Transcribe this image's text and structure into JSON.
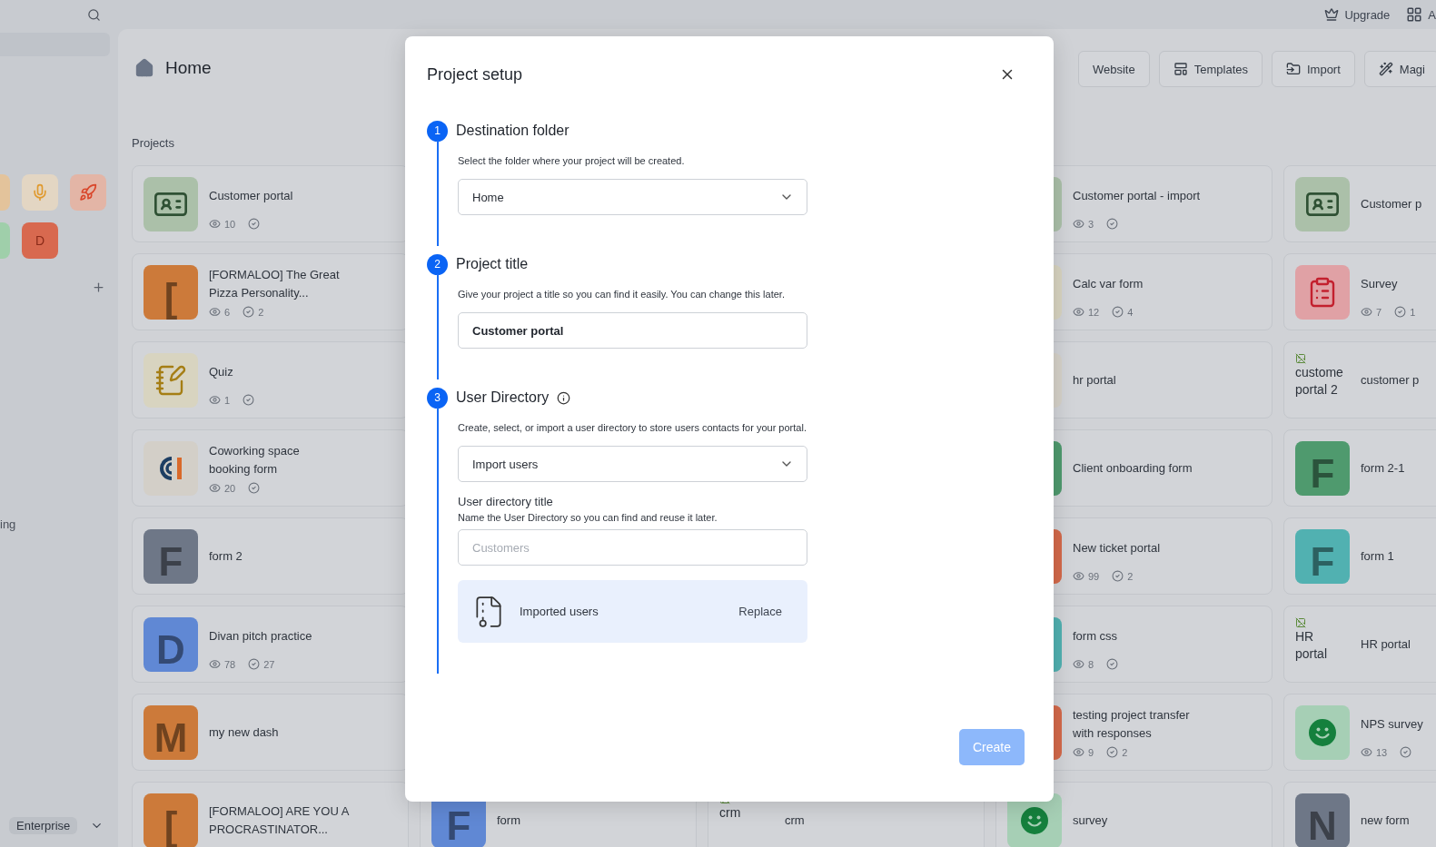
{
  "top_bar": {
    "actions": [
      {
        "label": "Upgrade"
      },
      {
        "label": "A"
      }
    ]
  },
  "sidebar": {
    "tiles": [
      {
        "kind": "blank",
        "color": "#e3c39b"
      },
      {
        "kind": "mic",
        "color": "#e3d6c3"
      },
      {
        "kind": "rocket",
        "color": "#e3b5a6"
      },
      {
        "kind": "blank",
        "color": "#9fcfaa"
      },
      {
        "kind": "letter",
        "label": "D",
        "color": "#d8694f"
      }
    ],
    "partial_label": "ing",
    "plan": "Enterprise"
  },
  "main": {
    "title": "Home",
    "section": "Projects",
    "toolbar": [
      {
        "label": "Website"
      },
      {
        "label": "Templates"
      },
      {
        "label": "Import"
      },
      {
        "label": "Magi"
      }
    ],
    "columns": [
      {
        "cards": [
          {
            "title": "Customer portal",
            "views": "10",
            "icon": {
              "kind": "id-card",
              "color": "#abc0a9"
            }
          },
          {
            "title": "[FORMALOO] The Great\nPizza Personality...",
            "views": "6",
            "checks": "2",
            "icon": {
              "kind": "letter",
              "label": "[",
              "color": "#cc7a3a"
            }
          },
          {
            "title": "Quiz",
            "views": "1",
            "icon": {
              "kind": "quiz",
              "color": "#d8d4c0"
            }
          },
          {
            "title": "Coworking space\nbooking form",
            "views": "20",
            "icon": {
              "kind": "logo",
              "color": "#d3cfc8"
            }
          },
          {
            "title": "form 2",
            "icon": {
              "kind": "letter",
              "label": "F",
              "color": "#6e7787"
            }
          },
          {
            "title": "Divan pitch practice",
            "views": "78",
            "checks": "27",
            "icon": {
              "kind": "letter",
              "label": "D",
              "color": "#6088d4"
            }
          },
          {
            "title": "my new dash",
            "icon": {
              "kind": "letter",
              "label": "M",
              "color": "#cc7a3a"
            }
          },
          {
            "title": "[FORMALOO] ARE YOU A\nPROCRASTINATOR...",
            "icon": {
              "kind": "letter",
              "label": "[",
              "color": "#cc7a3a"
            }
          }
        ]
      },
      {
        "cards": [
          {
            "title": "form",
            "icon": {
              "kind": "letter",
              "label": "F",
              "color": "#6088d4"
            }
          }
        ]
      },
      {
        "cards": [
          {
            "title": "crm",
            "icon": {
              "kind": "broken",
              "label": "crm"
            }
          }
        ]
      },
      {
        "cards": [
          {
            "title": "Customer portal - import",
            "views": "3",
            "icon": {
              "kind": "plain",
              "color": "#abc0a9"
            }
          },
          {
            "title": "Calc var form",
            "views": "12",
            "checks": "4",
            "icon": {
              "kind": "plain",
              "color": "#d8d4c0"
            }
          },
          {
            "title": "hr portal",
            "icon": {
              "kind": "plain",
              "color": "#d6d2c9"
            }
          },
          {
            "title": "Client onboarding form",
            "icon": {
              "kind": "plain",
              "color": "#4f9a6e"
            }
          },
          {
            "title": "New ticket portal",
            "views": "99",
            "checks": "2",
            "icon": {
              "kind": "plain",
              "color": "#d4694a"
            }
          },
          {
            "title": "form css",
            "views": "8",
            "icon": {
              "kind": "plain",
              "color": "#51b1b1"
            }
          },
          {
            "title": "testing project transfer\nwith responses",
            "views": "9",
            "checks": "2",
            "icon": {
              "kind": "plain",
              "color": "#d4694a"
            }
          },
          {
            "title": "survey",
            "icon": {
              "kind": "smile",
              "color": "#a6cfb5"
            }
          }
        ]
      },
      {
        "cards": [
          {
            "title": "Customer p",
            "icon": {
              "kind": "id-card",
              "color": "#abc0a9"
            }
          },
          {
            "title": "Survey",
            "views": "7",
            "checks": "1",
            "icon": {
              "kind": "survey",
              "color": "#e0a1a5"
            }
          },
          {
            "title": "customer p",
            "icon": {
              "kind": "broken",
              "label": "custome\nportal 2"
            }
          },
          {
            "title": "form 2-1",
            "icon": {
              "kind": "letter",
              "label": "F",
              "color": "#4f9a6e"
            }
          },
          {
            "title": "form 1",
            "icon": {
              "kind": "letter",
              "label": "F",
              "color": "#51b1b1"
            }
          },
          {
            "title": "HR portal",
            "icon": {
              "kind": "broken",
              "label": "HR\nportal"
            }
          },
          {
            "title": "NPS survey",
            "views": "13",
            "icon": {
              "kind": "smile",
              "color": "#a6cfb5"
            }
          },
          {
            "title": "new form",
            "icon": {
              "kind": "letter",
              "label": "N",
              "color": "#6e7787"
            }
          }
        ]
      }
    ]
  },
  "modal": {
    "title": "Project setup",
    "steps": [
      {
        "number": "1",
        "title": "Destination folder",
        "info": false,
        "description": "Select the folder where your project will be created.",
        "fields": [
          {
            "kind": "select",
            "value": "Home"
          }
        ]
      },
      {
        "number": "2",
        "title": "Project title",
        "info": false,
        "description": "Give your project a title so you can find it easily. You can change this later.",
        "fields": [
          {
            "kind": "input",
            "value": "Customer portal"
          }
        ]
      },
      {
        "number": "3",
        "title": "User Directory",
        "info": true,
        "description": "Create, select, or import a user directory to store users contacts for your portal.",
        "fields": [
          {
            "kind": "select",
            "value": "Import users"
          },
          {
            "kind": "labeled_input",
            "label": "User directory title",
            "hint": "Name the User Directory so you can find and reuse it later.",
            "placeholder": "Customers"
          },
          {
            "kind": "file",
            "name": "Imported users",
            "action": "Replace"
          }
        ]
      }
    ],
    "create_button": {
      "label": "Create",
      "disabled": true
    }
  }
}
